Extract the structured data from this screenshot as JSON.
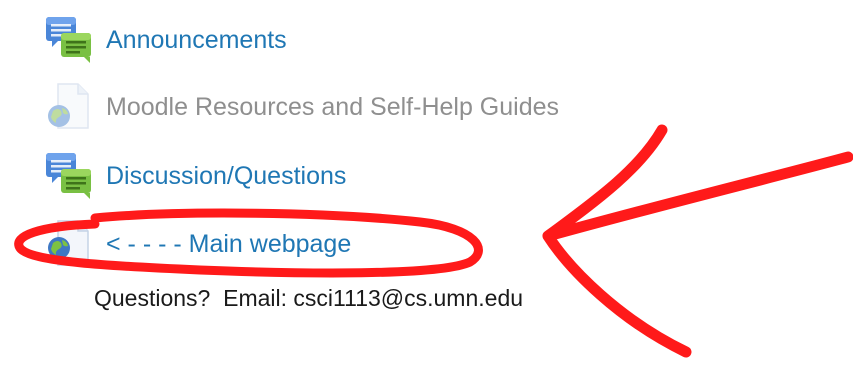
{
  "activities": [
    {
      "label": "Announcements",
      "icon": "forum-icon",
      "state": "link"
    },
    {
      "label": "Moodle Resources and Self-Help Guides",
      "icon": "url-resource-icon",
      "state": "dimmed"
    },
    {
      "label": "Discussion/Questions",
      "icon": "forum-icon",
      "state": "link"
    },
    {
      "label": "< - - - - Main webpage",
      "icon": "url-resource-icon",
      "state": "link"
    }
  ],
  "note": {
    "text": "Questions?  Email: csci1113@cs.umn.edu"
  },
  "colors": {
    "link": "#1f77b4",
    "dimmed": "#8f8f8f",
    "annotation": "#ff1a1a",
    "forum_blue": "#3f7fd6",
    "forum_green": "#7dc242"
  }
}
